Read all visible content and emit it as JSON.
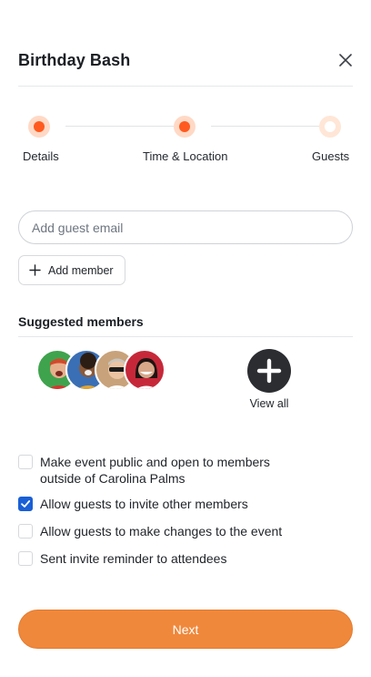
{
  "header": {
    "title": "Birthday Bash",
    "close_icon": "close-icon"
  },
  "stepper": {
    "active_color": "#ff5a1f",
    "steps": [
      {
        "label": "Details",
        "state": "complete"
      },
      {
        "label": "Time & Location",
        "state": "active"
      },
      {
        "label": "Guests",
        "state": "pending"
      }
    ]
  },
  "guest_email": {
    "placeholder": "Add guest email",
    "value": ""
  },
  "add_member": {
    "label": "Add member",
    "icon": "plus-icon"
  },
  "suggested": {
    "title": "Suggested members",
    "avatars": [
      {
        "name": "avatar-1",
        "bg": "#3fa34d"
      },
      {
        "name": "avatar-2",
        "bg": "#3a6fb5"
      },
      {
        "name": "avatar-3",
        "bg": "#c8a27a"
      },
      {
        "name": "avatar-4",
        "bg": "#c62839"
      }
    ],
    "view_all_label": "View all",
    "view_all_icon": "plus-icon"
  },
  "options": [
    {
      "lines": [
        "Make event public and open to members",
        "outside of Carolina Palms"
      ],
      "checked": false
    },
    {
      "lines": [
        "Allow guests to invite other members"
      ],
      "checked": true
    },
    {
      "lines": [
        "Allow guests to make changes to the event"
      ],
      "checked": false
    },
    {
      "lines": [
        "Sent invite reminder to attendees"
      ],
      "checked": false
    }
  ],
  "footer": {
    "next_label": "Next",
    "next_color": "#f0883b"
  }
}
